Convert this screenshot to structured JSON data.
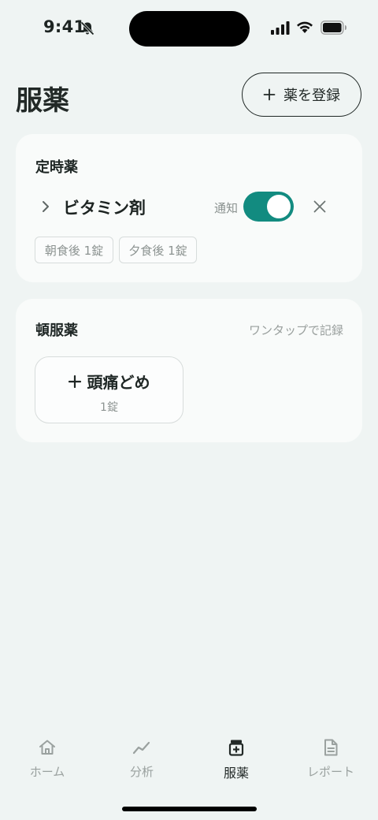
{
  "status_bar": {
    "time": "9:41"
  },
  "header": {
    "title": "服薬",
    "register_label": "薬を登録"
  },
  "scheduled": {
    "title": "定時薬",
    "med": {
      "name": "ビタミン剤",
      "notify_label": "通知",
      "notify_on": true,
      "chips": [
        "朝食後 1錠",
        "夕食後 1錠"
      ]
    }
  },
  "as_needed": {
    "title": "頓服薬",
    "hint": "ワンタップで記録",
    "quick": {
      "name": "頭痛どめ",
      "dose": "1錠"
    }
  },
  "tabs": [
    {
      "label": "ホーム",
      "icon": "home-icon"
    },
    {
      "label": "分析",
      "icon": "chart-line-icon"
    },
    {
      "label": "服薬",
      "icon": "medicine-icon",
      "active": true
    },
    {
      "label": "レポート",
      "icon": "document-icon"
    }
  ],
  "colors": {
    "accent": "#128b80",
    "background": "#eff4f3",
    "card": "#f9fbfa"
  }
}
